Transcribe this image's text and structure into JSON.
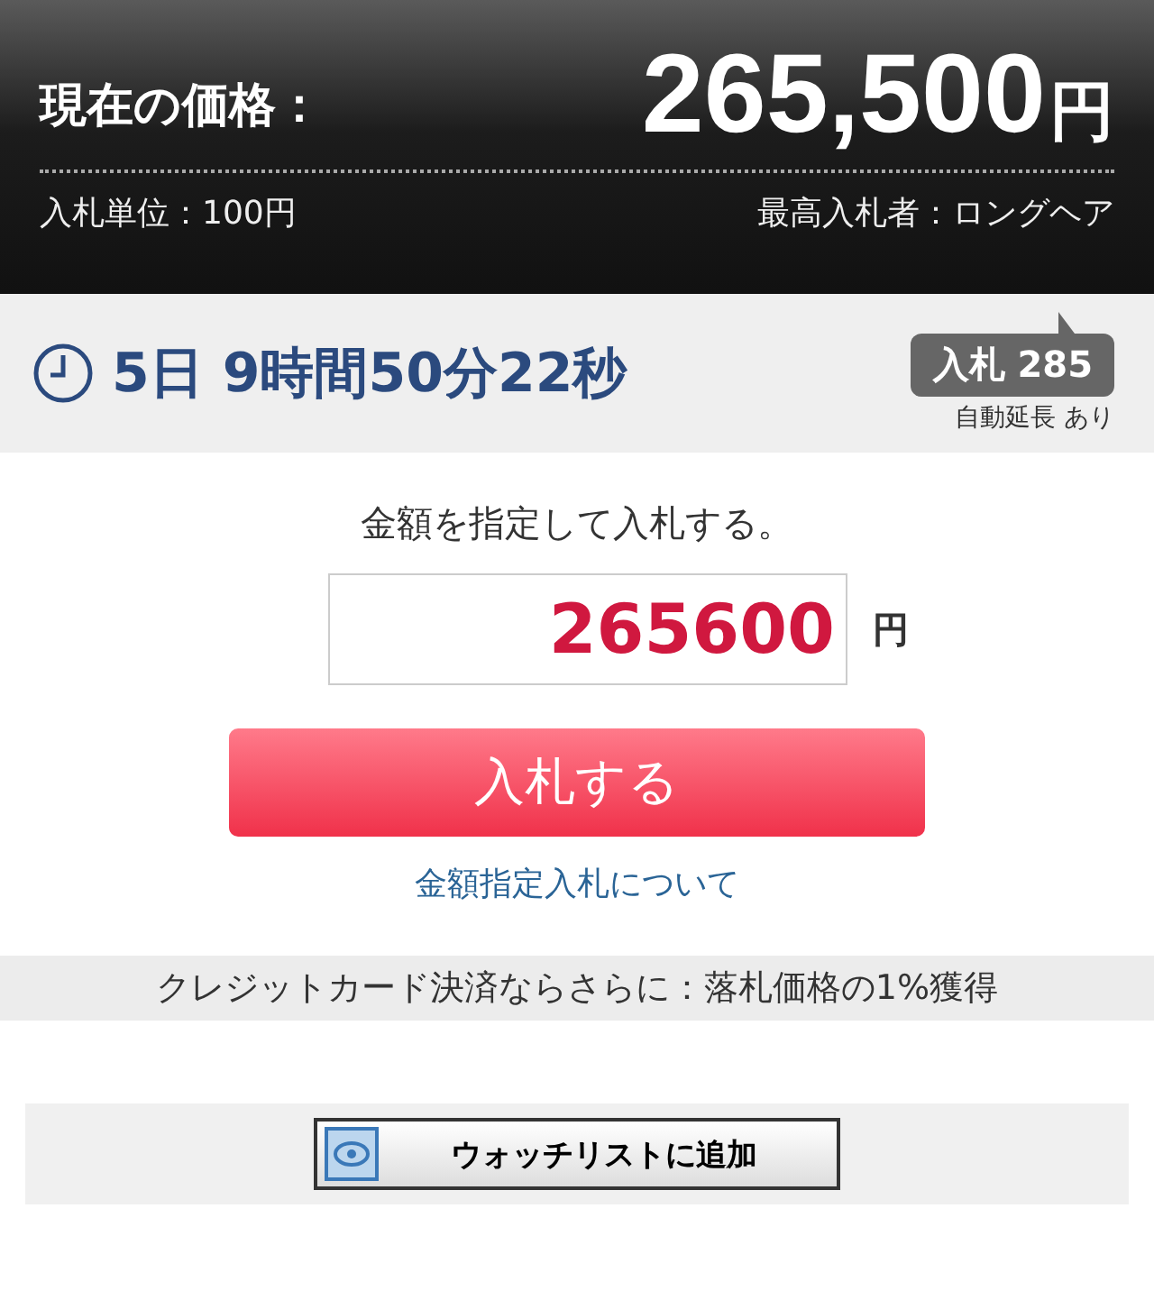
{
  "header": {
    "label": "現在の価格：",
    "price": "265,500",
    "currency": "円",
    "bid_unit": "入札単位：100円",
    "top_bidder": "最高入札者：ロングヘア"
  },
  "status": {
    "time_left": "5日 9時間50分22秒",
    "bids": "入札 285",
    "auto_extension": "自動延長 あり"
  },
  "bid_form": {
    "prompt": "金額を指定して入札する。",
    "amount": "265600",
    "currency": "円",
    "submit": "入札する",
    "help_link": "金額指定入札について"
  },
  "credit_note": "クレジットカード決済ならさらに：落札価格の1%獲得",
  "watch_button": "ウォッチリストに追加"
}
